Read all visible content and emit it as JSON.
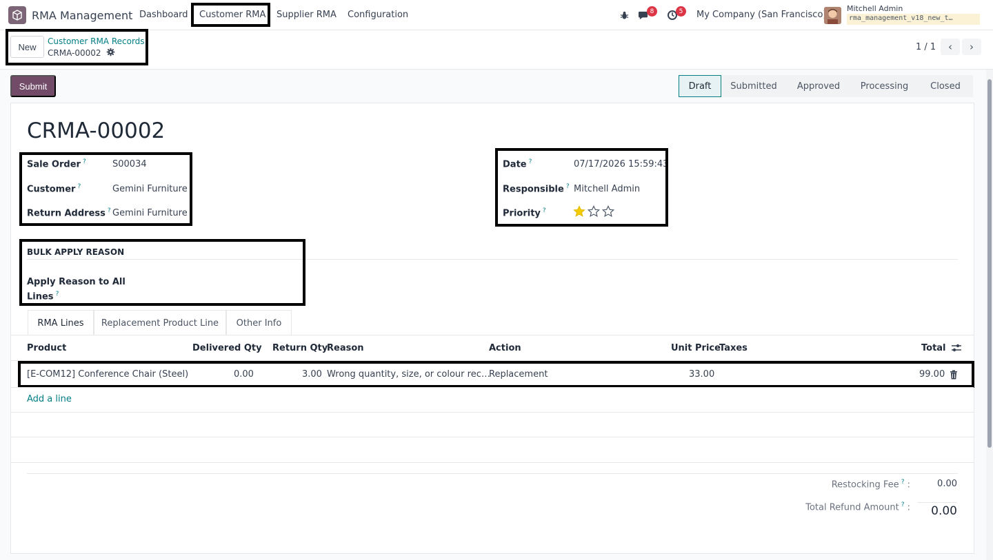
{
  "navbar": {
    "app_name": "RMA Management",
    "menu": [
      "Dashboard",
      "Customer RMA",
      "Supplier RMA",
      "Configuration"
    ],
    "messages_badge": "8",
    "activities_badge": "5",
    "company": "My Company (San Francisco)",
    "user_name": "Mitchell Admin",
    "db_name": "rma_management_v18_new_t…"
  },
  "control_panel": {
    "new_label": "New",
    "breadcrumb": "Customer RMA Records",
    "record_name": "CRMA-00002",
    "pager": "1 / 1"
  },
  "statusbar": {
    "submit_label": "Submit",
    "stages": [
      "Draft",
      "Submitted",
      "Approved",
      "Processing",
      "Closed"
    ],
    "active_stage": "Draft"
  },
  "form": {
    "title": "CRMA-00002",
    "sale_order_label": "Sale Order",
    "sale_order": "S00034",
    "customer_label": "Customer",
    "customer": "Gemini Furniture",
    "return_address_label": "Return Address",
    "return_address": "Gemini Furniture",
    "date_label": "Date",
    "date": "07/17/2026 15:59:43",
    "responsible_label": "Responsible",
    "responsible": "Mitchell Admin",
    "priority_label": "Priority",
    "priority_stars": 1,
    "priority_max": 3,
    "help_mark": "?",
    "bulk_section": "BULK APPLY REASON",
    "apply_reason_label_1": "Apply Reason to All",
    "apply_reason_label_2": "Lines"
  },
  "tabs": [
    "RMA Lines",
    "Replacement Product Line",
    "Other Info"
  ],
  "lines": {
    "headers": {
      "product": "Product",
      "delivered": "Delivered Qty",
      "return": "Return Qty",
      "reason": "Reason",
      "action": "Action",
      "unit_price": "Unit Price",
      "taxes": "Taxes",
      "total": "Total"
    },
    "rows": [
      {
        "product": "[E-COM12] Conference Chair (Steel)",
        "delivered": "0.00",
        "return": "3.00",
        "reason": "Wrong quantity, size, or colour rec…",
        "action": "Replacement",
        "unit_price": "33.00",
        "taxes": "",
        "total": "99.00"
      }
    ],
    "add_line": "Add a line"
  },
  "totals": {
    "restocking_label": "Restocking Fee",
    "restocking_value": "0.00",
    "refund_label": "Total Refund Amount",
    "refund_value": "0.00",
    "colon": ":"
  },
  "colors": {
    "primary": "#714b67",
    "link": "#017e84",
    "star": "#f3cc00",
    "badge": "#dc3545"
  }
}
